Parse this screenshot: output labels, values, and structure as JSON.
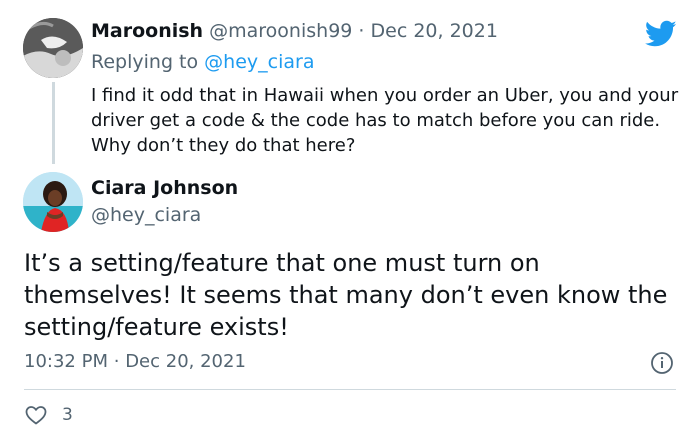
{
  "reply_tweet": {
    "display_name": "Maroonish",
    "handle": "@maroonish99",
    "separator": "·",
    "date": "Dec 20, 2021",
    "replying_to_label": "Replying to",
    "replying_to_handle": "@hey_ciara",
    "text": "I find it odd that in Hawaii when you order an Uber, you and your driver get a code & the code has to match before you can ride. Why don’t they do that here?"
  },
  "main_tweet": {
    "display_name": "Ciara Johnson",
    "handle": "@hey_ciara",
    "text": "It’s a setting/feature that one must turn on themselves! It seems that many don’t even know the setting/feature exists!",
    "time": "10:32 PM",
    "separator": "·",
    "date": "Dec 20, 2021",
    "like_count": "3"
  },
  "icons": {
    "brand": "twitter-bird-icon",
    "info": "info-icon",
    "like": "heart-icon"
  },
  "colors": {
    "brand": "#1d9bf0",
    "text": "#0f1419",
    "muted": "#536471",
    "divider": "#cfd9de"
  }
}
